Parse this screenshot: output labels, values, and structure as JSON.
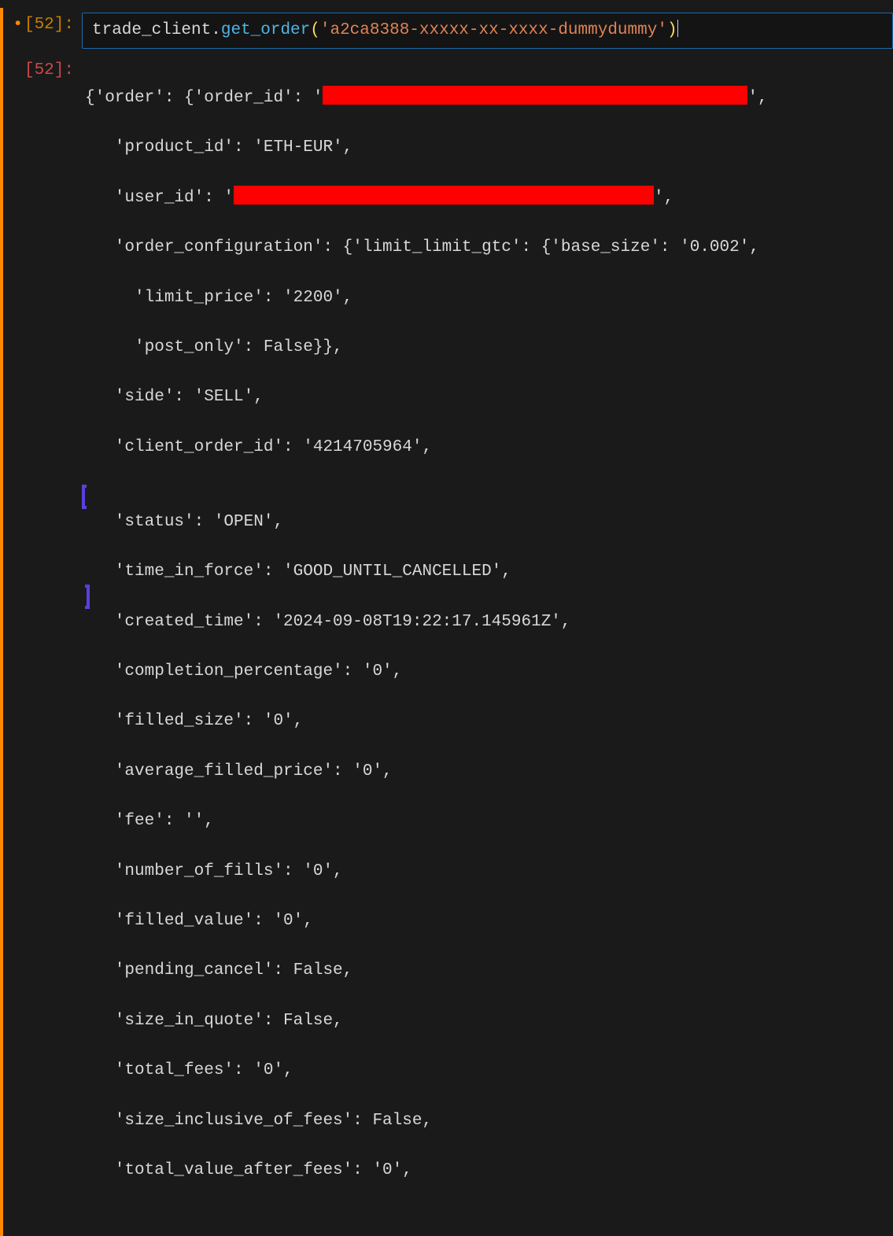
{
  "input": {
    "prompt_num": "52",
    "dirty": "•",
    "code": {
      "object": "trade_client",
      "method": "get_order",
      "arg": "'a2ca8388-xxxxx-xx-xxxx-dummydummy'"
    }
  },
  "output": {
    "prompt_num": "52",
    "lines": {
      "l0_pre": "{'order': {'order_id': '",
      "l0_post": "',",
      "l1": "   'product_id': 'ETH-EUR',",
      "l2_pre": "   'user_id': '",
      "l2_post": "',",
      "l3": "   'order_configuration': {'limit_limit_gtc': {'base_size': '0.002',",
      "l4": "     'limit_price': '2200',",
      "l5": "     'post_only': False}},",
      "l6": "   'side': 'SELL',",
      "l7": "   'client_order_id': '4214705964',",
      "l8": "   'status': 'OPEN',                       ",
      "l9": "   'time_in_force': 'GOOD_UNTIL_CANCELLED',",
      "l10": "   'created_time': '2024-09-08T19:22:17.145961Z',",
      "l11": "   'completion_percentage': '0',",
      "l12": "   'filled_size': '0',",
      "l13": "   'average_filled_price': '0',",
      "l14": "   'fee': '',",
      "l15": "   'number_of_fills': '0',",
      "l16": "   'filled_value': '0',",
      "l17": "   'pending_cancel': False,",
      "l18": "   'size_in_quote': False,",
      "l19": "   'total_fees': '0',",
      "l20": "   'size_inclusive_of_fees': False,",
      "l21": "   'total_value_after_fees': '0',"
    }
  }
}
